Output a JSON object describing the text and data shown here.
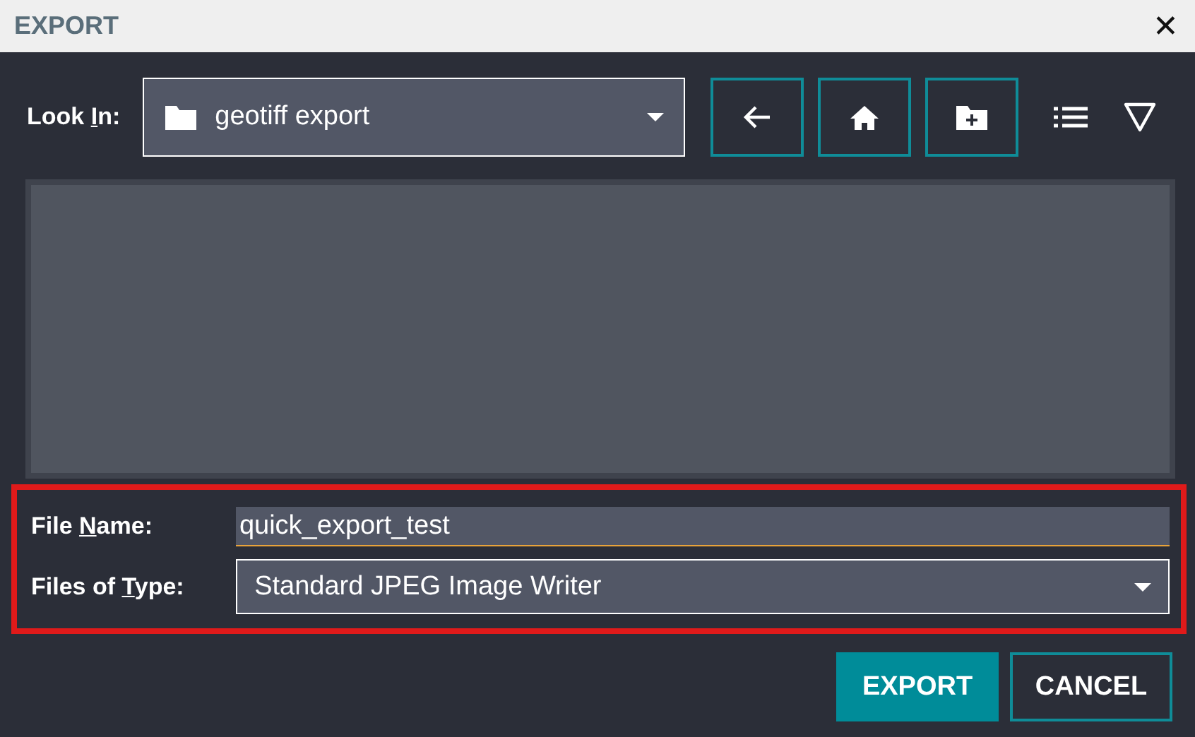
{
  "window": {
    "title": "EXPORT",
    "close": "✕"
  },
  "look_in": {
    "label_parts": [
      "Look ",
      "I",
      "n:"
    ],
    "value": "geotiff export"
  },
  "toolbar": [
    {
      "kind": "back"
    },
    {
      "kind": "home"
    },
    {
      "kind": "new-folder"
    },
    {
      "kind": "list-view"
    },
    {
      "kind": "filter"
    }
  ],
  "form": {
    "highlighted": true,
    "file_name": {
      "label_parts": [
        "File ",
        "N",
        "ame:"
      ],
      "value": "quick_export_test"
    },
    "file_type": {
      "label_parts": [
        "Files of ",
        "T",
        "ype:"
      ],
      "value": "Standard JPEG Image Writer"
    }
  },
  "buttons": [
    {
      "label": "EXPORT",
      "kind": "primary"
    },
    {
      "label": "CANCEL",
      "kind": "secondary"
    }
  ]
}
